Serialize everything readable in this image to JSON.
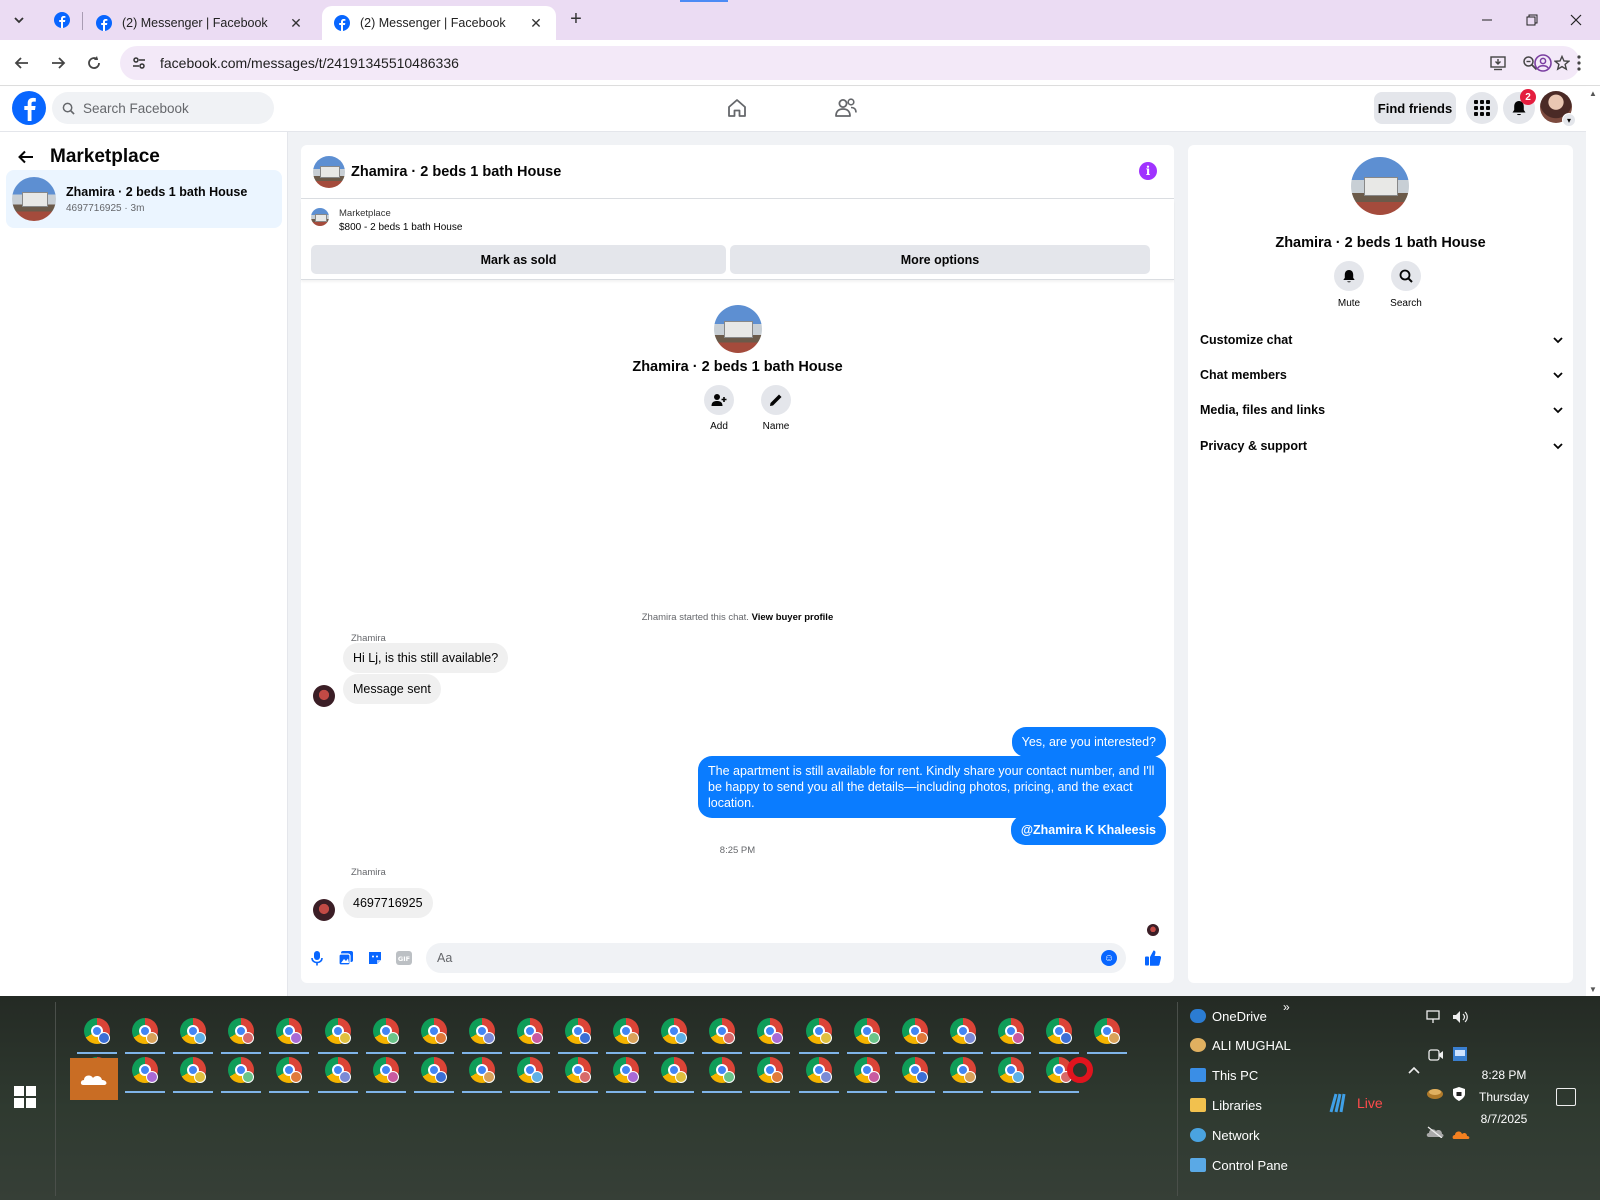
{
  "browser": {
    "tabs": [
      {
        "title": "(2) Messenger | Facebook"
      },
      {
        "title": "(2) Messenger | Facebook"
      }
    ],
    "url": "facebook.com/messages/t/24191345510486336"
  },
  "fb_header": {
    "search_placeholder": "Search Facebook",
    "find_friends": "Find friends",
    "notification_count": "2"
  },
  "sidebar": {
    "title": "Marketplace",
    "thread": {
      "name": "Zhamira · 2 beds 1 bath House",
      "sub": "4697716925 · 3m"
    }
  },
  "chat": {
    "title": "Zhamira · 2 beds 1 bath House",
    "marketplace_label": "Marketplace",
    "listing": "$800 - 2 beds 1 bath House",
    "mark_sold": "Mark as sold",
    "more_options": "More options",
    "intro_name": "Zhamira · 2 beds 1 bath House",
    "add_label": "Add",
    "name_label": "Name",
    "started_text": "Zhamira started this chat.",
    "view_buyer": "View buyer profile",
    "sender": "Zhamira",
    "msg_in_1": "Hi Lj, is this still available?",
    "msg_in_2": "Message sent",
    "msg_out_1": "Yes, are you interested?",
    "msg_out_2": "The apartment is still available for rent. Kindly share your contact number, and I'll be happy to send you all the details—including photos, pricing, and the exact location.",
    "msg_out_3": "@Zhamira K Khaleesis",
    "timestamp": "8:25 PM",
    "msg_in_3": "4697716925",
    "composer_placeholder": "Aa"
  },
  "details": {
    "name": "Zhamira · 2 beds 1 bath House",
    "mute": "Mute",
    "search": "Search",
    "sections": [
      "Customize chat",
      "Chat members",
      "Media, files and links",
      "Privacy & support"
    ]
  },
  "taskbar": {
    "items": [
      "OneDrive",
      "ALI MUGHAL",
      "This PC",
      "Libraries",
      "Network",
      "Control Pane"
    ],
    "live": "Live",
    "time": "8:28 PM",
    "day": "Thursday",
    "date": "8/7/2025"
  },
  "colors": {
    "fb_blue": "#0866ff",
    "outgoing_bubble": "#0a7cff",
    "tabstrip": "#ebdcf3"
  }
}
